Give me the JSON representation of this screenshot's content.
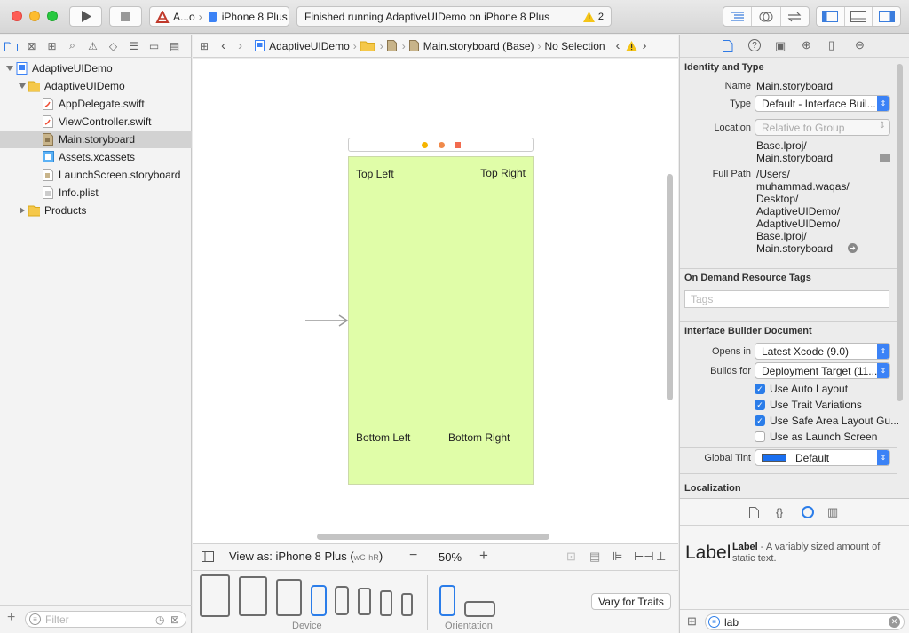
{
  "toolbar": {
    "scheme_name": "A...o",
    "device": "iPhone 8 Plus",
    "activity_text": "Finished running AdaptiveUIDemo on iPhone 8 Plus",
    "warning_count": "2"
  },
  "navigator": {
    "filter_placeholder": "Filter",
    "items": [
      {
        "label": "AdaptiveUIDemo"
      },
      {
        "label": "AdaptiveUIDemo"
      },
      {
        "label": "AppDelegate.swift"
      },
      {
        "label": "ViewController.swift"
      },
      {
        "label": "Main.storyboard"
      },
      {
        "label": "Assets.xcassets"
      },
      {
        "label": "LaunchScreen.storyboard"
      },
      {
        "label": "Info.plist"
      },
      {
        "label": "Products"
      }
    ]
  },
  "jumpbar": {
    "crumbs": [
      "AdaptiveUIDemo",
      "Main.storyboard (Base)",
      "No Selection"
    ]
  },
  "canvas": {
    "labels": {
      "top_left": "Top Left",
      "top_right": "Top Right",
      "bottom_left": "Bottom Left",
      "bottom_right": "Bottom Right"
    },
    "view_bg": "#e0fda8"
  },
  "editor_bottom": {
    "view_as_prefix": "View as: iPhone 8 Plus (",
    "size_class_w": "wC",
    "size_class_h": "hR",
    "view_as_suffix": ")",
    "zoom": "50%",
    "device_label": "Device",
    "orientation_label": "Orientation",
    "vary_button": "Vary for Traits"
  },
  "inspector": {
    "identity_title": "Identity and Type",
    "name_label": "Name",
    "name_value": "Main.storyboard",
    "type_label": "Type",
    "type_value": "Default - Interface Buil...",
    "location_label": "Location",
    "location_value": "Relative to Group",
    "location_path_1": "Base.lproj/",
    "location_path_2": "Main.storyboard",
    "fullpath_label": "Full Path",
    "fullpath_lines": [
      "/Users/",
      "muhammad.waqas/",
      "Desktop/",
      "AdaptiveUIDemo/",
      "AdaptiveUIDemo/",
      "Base.lproj/",
      "Main.storyboard"
    ],
    "odr_title": "On Demand Resource Tags",
    "tags_placeholder": "Tags",
    "ibdoc_title": "Interface Builder Document",
    "opens_in_label": "Opens in",
    "opens_in_value": "Latest Xcode (9.0)",
    "builds_for_label": "Builds for",
    "builds_for_value": "Deployment Target (11....",
    "checks": [
      {
        "label": "Use Auto Layout",
        "checked": true
      },
      {
        "label": "Use Trait Variations",
        "checked": true
      },
      {
        "label": "Use Safe Area Layout Gu...",
        "checked": true
      },
      {
        "label": "Use as Launch Screen",
        "checked": false
      }
    ],
    "tint_label": "Global Tint",
    "tint_value": "Default",
    "tint_color": "#1a6ff0",
    "localization_title": "Localization"
  },
  "library": {
    "item_big": "Label",
    "item_title": "Label",
    "item_desc": " - A variably sized amount of static text.",
    "search_value": "lab"
  }
}
